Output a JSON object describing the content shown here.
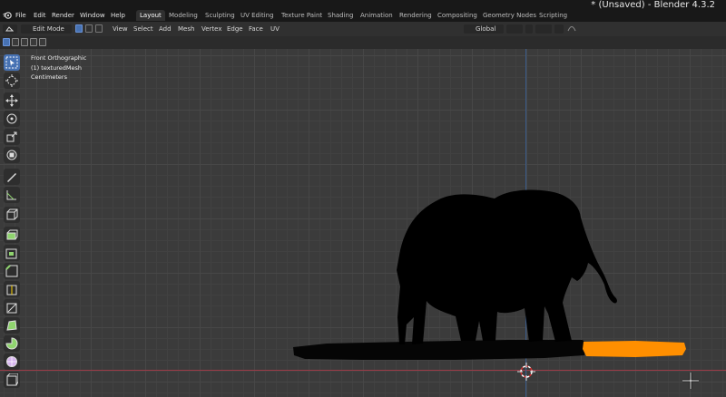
{
  "window": {
    "title": "* (Unsaved) - Blender 4.3.2"
  },
  "menu": [
    "File",
    "Edit",
    "Render",
    "Window",
    "Help"
  ],
  "workspaces": [
    "Layout",
    "Modeling",
    "Sculpting",
    "UV Editing",
    "Texture Paint",
    "Shading",
    "Animation",
    "Rendering",
    "Compositing",
    "Geometry Nodes",
    "Scripting"
  ],
  "active_workspace": "Layout",
  "header": {
    "mode": "Edit Mode",
    "menus": [
      "View",
      "Select",
      "Add",
      "Mesh",
      "Vertex",
      "Edge",
      "Face",
      "UV"
    ],
    "transform_orientation": "Global"
  },
  "viewport": {
    "view_name": "Front Orthographic",
    "object_label": "(1) texturedMesh",
    "units": "Centimeters"
  },
  "colors": {
    "accent": "#4772b3",
    "selection": "#ff8a00",
    "x_axis": "#9c3b48",
    "z_axis": "#3a5b8a"
  },
  "icons": {
    "blender_logo": "blender-logo-icon",
    "tools": [
      "select-box-icon",
      "cursor-icon",
      "move-icon",
      "rotate-icon",
      "scale-icon",
      "transform-icon",
      "annotate-icon",
      "measure-icon",
      "add-cube-icon",
      "extrude-region-icon",
      "inset-faces-icon",
      "bevel-icon",
      "loop-cut-icon",
      "knife-icon",
      "poly-build-icon",
      "spin-icon",
      "smooth-icon",
      "edge-slide-icon",
      "shrink-fatten-icon"
    ]
  }
}
